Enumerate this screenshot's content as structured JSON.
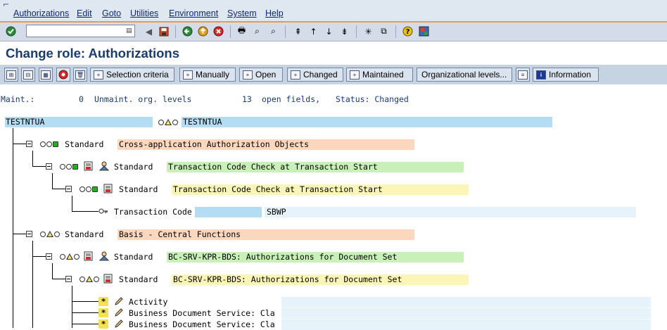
{
  "colors": {
    "menubar_bg": "#dfe7f0",
    "accent_line": "#e79a4a",
    "title_text": "#1c3c6c",
    "bar_blue": "#b4dcf2",
    "bar_orange": "#fbd8bd",
    "bar_green": "#c8f0b8",
    "bar_yellow": "#fbf6b6",
    "bar_lightblue": "#e6f3fb"
  },
  "menubar": {
    "items": [
      "Authorizations",
      "Edit",
      "Goto",
      "Utilities",
      "Environment",
      "System",
      "Help"
    ]
  },
  "toolbar": {
    "command_placeholder": "",
    "command_value": ""
  },
  "title": "Change role: Authorizations",
  "app_toolbar": {
    "selection_criteria": "Selection criteria",
    "manually": "Manually",
    "open": "Open",
    "changed": "Changed",
    "maintained": "Maintained",
    "org_levels": "Organizational levels...",
    "information": "Information"
  },
  "status": {
    "maint_label": "Maint.:",
    "maint_count": "0",
    "unmaint_label": "Unmaint. org. levels",
    "open_count": "13",
    "open_label": "open fields,",
    "status_label": "Status: Changed"
  },
  "tree": {
    "root_left": "TESTNTUA",
    "root_right": "TESTNTUA",
    "nodes": [
      {
        "type": "Standard",
        "text": "Cross-application Authorization Objects"
      },
      {
        "type": "Standard",
        "text": "Transaction Code Check at Transaction Start"
      },
      {
        "type": "Standard",
        "text": "Transaction Code Check at Transaction Start"
      },
      {
        "type": "Transaction Code",
        "text": "SBWP"
      },
      {
        "type": "Standard",
        "text": "Basis - Central Functions"
      },
      {
        "type": "Standard",
        "text": "BC-SRV-KPR-BDS: Authorizations for Document Set"
      },
      {
        "type": "Standard",
        "text": "BC-SRV-KPR-BDS: Authorizations for Document Set"
      }
    ],
    "fields": [
      {
        "star": "*",
        "label": "Activity"
      },
      {
        "star": "*",
        "label": "Business Document Service: Cla"
      },
      {
        "star": "*",
        "label": "Business Document Service: Cla"
      }
    ]
  }
}
